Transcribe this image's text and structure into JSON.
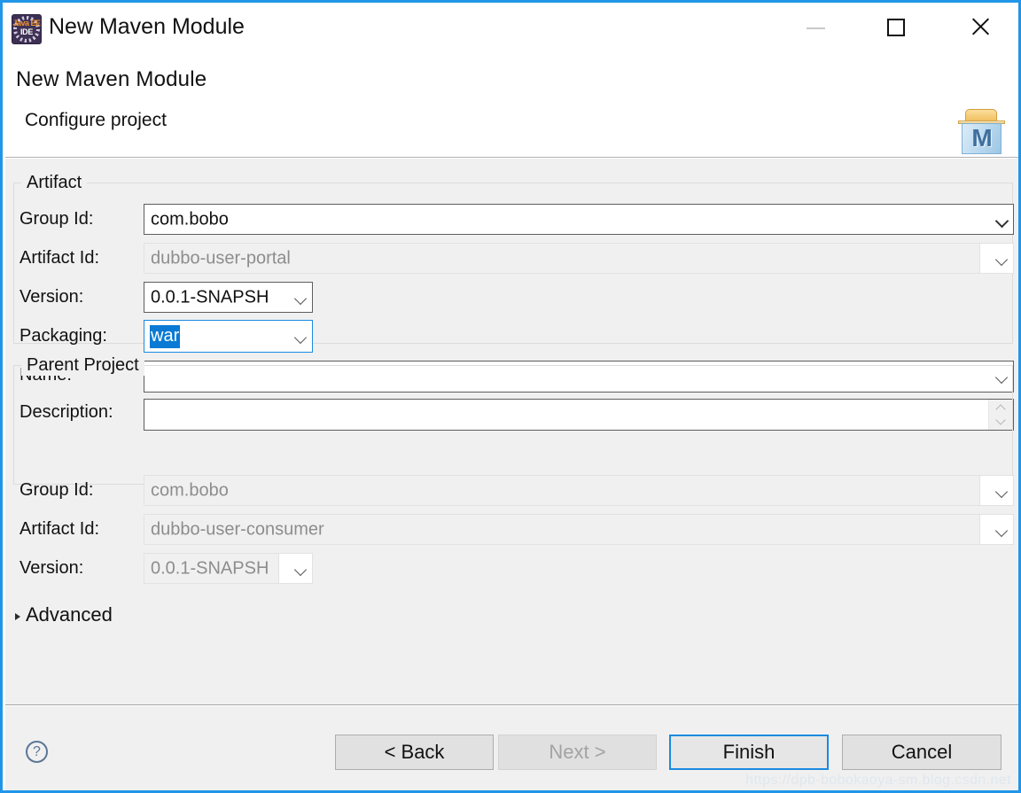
{
  "window": {
    "title": "New Maven Module",
    "app_icon": "eclipse-javaee-ide-icon",
    "icon_line1": "Java EE",
    "icon_line2": "IDE",
    "controls": {
      "minimize": "minimize-icon",
      "maximize": "maximize-icon",
      "close": "close-icon"
    }
  },
  "header": {
    "title": "New Maven Module",
    "subtitle": "Configure project",
    "banner_icon": "maven-folder-icon",
    "banner_icon_letter": "M"
  },
  "artifact": {
    "legend": "Artifact",
    "fields": [
      {
        "label": "Group Id:",
        "value": "com.bobo",
        "enabled": true,
        "focused": false,
        "type": "combo"
      },
      {
        "label": "Artifact Id:",
        "value": "dubbo-user-portal",
        "enabled": false,
        "focused": false,
        "type": "combo"
      },
      {
        "label": "Version:",
        "value": "0.0.1-SNAPSH",
        "enabled": true,
        "focused": false,
        "type": "combo"
      },
      {
        "label": "Packaging:",
        "value": "war",
        "enabled": true,
        "focused": true,
        "selected": true,
        "type": "combo"
      },
      {
        "label": "Name:",
        "value": "",
        "enabled": true,
        "focused": false,
        "type": "combo"
      },
      {
        "label": "Description:",
        "value": "",
        "enabled": true,
        "focused": false,
        "type": "textarea"
      }
    ]
  },
  "parent_project": {
    "legend": "Parent Project",
    "fields": [
      {
        "label": "Group Id:",
        "value": "com.bobo",
        "enabled": false,
        "type": "combo"
      },
      {
        "label": "Artifact Id:",
        "value": "dubbo-user-consumer",
        "enabled": false,
        "type": "combo"
      },
      {
        "label": "Version:",
        "value": "0.0.1-SNAPSH",
        "enabled": false,
        "type": "combo"
      }
    ]
  },
  "advanced": {
    "label": "Advanced",
    "expanded": false,
    "icon": "triangle-right-icon"
  },
  "footer": {
    "help_icon": "help-question-icon",
    "help_glyph": "?",
    "buttons": [
      {
        "label": "< Back",
        "enabled": true,
        "default": false
      },
      {
        "label": "Next >",
        "enabled": false,
        "default": false
      },
      {
        "label": "Finish",
        "enabled": true,
        "default": true
      },
      {
        "label": "Cancel",
        "enabled": true,
        "default": false
      }
    ]
  },
  "watermark": "https://dpb-bobokaoya-sm.blog.csdn.net",
  "colors": {
    "window_border": "#2196e8",
    "focus_blue": "#1a8ae0",
    "selection_blue": "#0a7ad4",
    "body_bg": "#f0f0f0",
    "disabled_text": "#8d8d8d"
  }
}
